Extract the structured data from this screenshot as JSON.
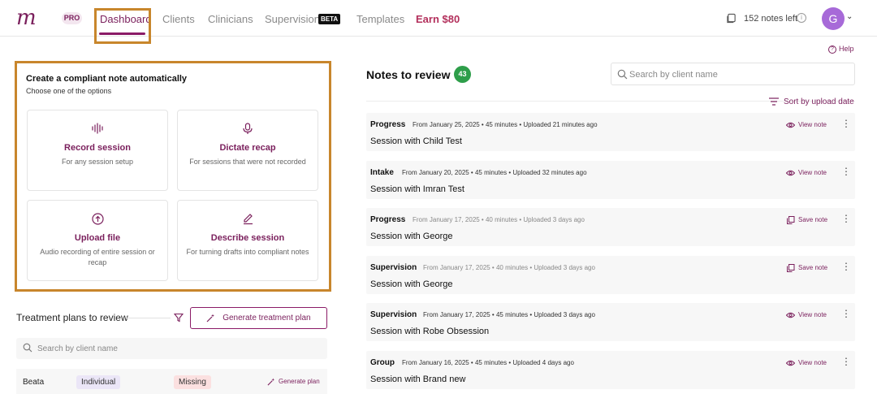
{
  "nav": {
    "logo": "m",
    "pro": "PRO",
    "items": [
      "Dashboard",
      "Clients",
      "Clinicians",
      "Supervision",
      "Templates",
      "Earn $80"
    ],
    "beta": "BETA",
    "notes_left": "152 notes left",
    "info": "i",
    "avatar": "G",
    "chevron": "⌄"
  },
  "help": "Help",
  "create": {
    "title": "Create a compliant note automatically",
    "subtitle": "Choose one of the options",
    "options": [
      {
        "icon": "waveform-icon",
        "title": "Record session",
        "desc": "For any session setup"
      },
      {
        "icon": "microphone-icon",
        "title": "Dictate recap",
        "desc": "For sessions that were not recorded"
      },
      {
        "icon": "upload-icon",
        "title": "Upload file",
        "desc": "Audio recording of entire session or recap"
      },
      {
        "icon": "pen-icon",
        "title": "Describe session",
        "desc": "For turning drafts into compliant notes"
      }
    ]
  },
  "treatment": {
    "title": "Treatment plans to review",
    "generate_label": "Generate treatment plan",
    "search_placeholder": "Search by client name",
    "rows": [
      {
        "name": "Beata",
        "type": "Individual",
        "status": "Missing",
        "action": "Generate plan"
      }
    ]
  },
  "notes": {
    "title": "Notes to review",
    "count": "43",
    "search_placeholder": "Search by client name",
    "sort_label": "Sort by upload date",
    "items": [
      {
        "type": "Progress",
        "meta": "From January 25, 2025 • 45 minutes • Uploaded 21 minutes ago",
        "session": "Session with Child Test",
        "action": "View note"
      },
      {
        "type": "Intake",
        "meta": "From January 20, 2025 • 45 minutes • Uploaded 32 minutes ago",
        "session": "Session with Imran Test",
        "action": "View note"
      },
      {
        "type": "Progress",
        "meta": "From January 17, 2025 • 40 minutes • Uploaded 3 days ago",
        "session": "Session with George",
        "action": "Save note"
      },
      {
        "type": "Supervision",
        "meta": "From January 17, 2025 • 40 minutes • Uploaded 3 days ago",
        "session": "Session with George",
        "action": "Save note"
      },
      {
        "type": "Supervision",
        "meta": "From January 17, 2025 • 45 minutes • Uploaded 3 days ago",
        "session": "Session with Robe Obsession",
        "action": "View note"
      },
      {
        "type": "Group",
        "meta": "From January 16, 2025 • 45 minutes • Uploaded 4 days ago",
        "session": "Session with Brand new",
        "action": "View note"
      }
    ]
  },
  "colors": {
    "brand": "#7a1f5c",
    "highlight": "#c8862c",
    "badge_green": "#2e9e4a"
  }
}
